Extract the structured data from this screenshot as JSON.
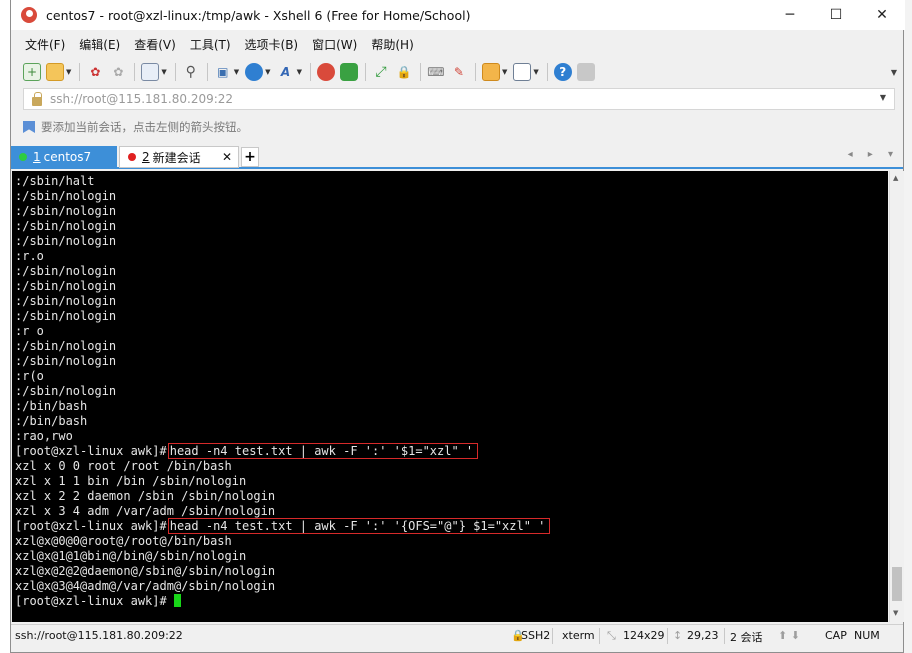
{
  "window": {
    "title": "centos7 - root@xzl-linux:/tmp/awk - Xshell 6 (Free for Home/School)",
    "minimize": "─",
    "maximize": "☐",
    "close": "✕"
  },
  "menu": [
    "文件(F)",
    "编辑(E)",
    "查看(V)",
    "工具(T)",
    "选项卡(B)",
    "窗口(W)",
    "帮助(H)"
  ],
  "address": {
    "value": "ssh://root@115.181.80.209:22"
  },
  "hint": "要添加当前会话，点击左侧的箭头按钮。",
  "tabs": [
    {
      "num": "1",
      "label": "centos7",
      "dot_color": "#2ecc40"
    },
    {
      "num": "2",
      "label": "新建会话",
      "dot_color": "#e02020"
    }
  ],
  "tab_add": "+",
  "tab_nav": "◂ ▸ ▾",
  "terminal": {
    "lines": [
      ":/sbin/halt",
      ":/sbin/nologin",
      ":/sbin/nologin",
      ":/sbin/nologin",
      ":/sbin/nologin",
      ":r.o",
      ":/sbin/nologin",
      ":/sbin/nologin",
      ":/sbin/nologin",
      ":/sbin/nologin",
      ":r o",
      ":/sbin/nologin",
      ":/sbin/nologin",
      ":r(o",
      ":/sbin/nologin",
      ":/bin/bash",
      ":/bin/bash",
      ":rao,rwo"
    ],
    "prompt": "[root@xzl-linux awk]#",
    "cmd1": "head -n4 test.txt | awk -F ':' '$1=\"xzl\" '",
    "out1": [
      "xzl x 0 0 root /root /bin/bash",
      "xzl x 1 1 bin /bin /sbin/nologin",
      "xzl x 2 2 daemon /sbin /sbin/nologin",
      "xzl x 3 4 adm /var/adm /sbin/nologin"
    ],
    "cmd2": "head -n4 test.txt | awk -F ':' '{OFS=\"@\"} $1=\"xzl\" '",
    "out2": [
      "xzl@x@0@0@root@/root@/bin/bash",
      "xzl@x@1@1@bin@/bin@/sbin/nologin",
      "xzl@x@2@2@daemon@/sbin@/sbin/nologin",
      "xzl@x@3@4@adm@/var/adm@/sbin/nologin"
    ]
  },
  "status": {
    "connection": "ssh://root@115.181.80.209:22",
    "protocol": "SSH2",
    "term": "xterm",
    "size": "124x29",
    "pos": "29,23",
    "sessions": "2 会话",
    "caps": "CAP",
    "num": "NUM"
  },
  "icons": {
    "app": "xshell-logo-icon",
    "toolbar": [
      "new-session-icon",
      "open-folder-icon",
      "reconnect-icon",
      "disconnect-icon",
      "properties-icon",
      "find-icon",
      "transfer-icon",
      "globe-icon",
      "font-icon",
      "xshell-icon",
      "xftp-icon",
      "fullscreen-icon",
      "lock-icon",
      "keyboard-icon",
      "highlight-icon",
      "new-window-icon",
      "layout-icon",
      "help-icon",
      "chat-icon"
    ]
  }
}
